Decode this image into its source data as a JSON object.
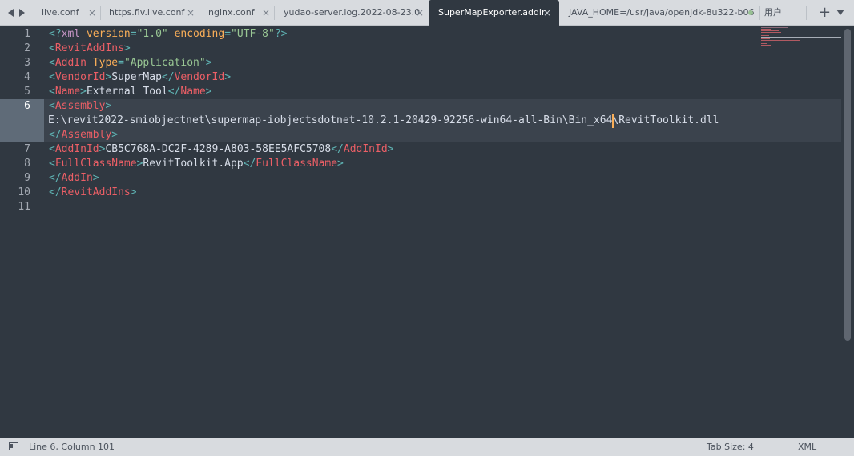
{
  "tabs": [
    {
      "label": "live.conf",
      "active": false
    },
    {
      "label": "https.flv.live.conf",
      "active": false
    },
    {
      "label": "nginx.conf",
      "active": false
    },
    {
      "label": "yudao-server.log.2022-08-23.0",
      "active": false
    },
    {
      "label": "SuperMapExporter.addin",
      "active": true
    },
    {
      "label": "JAVA_HOME=/usr/java/openjdk-8u322-b06",
      "active": false
    },
    {
      "label": "用户",
      "active": false
    }
  ],
  "tab_close_glyph": "×",
  "tab_new_glyph": "+",
  "icons": [
    "back-icon",
    "forward-icon",
    "close-icon",
    "modified-dot-icon",
    "plus-icon",
    "chevron-down-icon",
    "panel-icon"
  ],
  "editor": {
    "line_numbers": [
      "1",
      "2",
      "3",
      "4",
      "5",
      "6",
      "7",
      "8",
      "9",
      "10",
      "11"
    ],
    "current_line": "6",
    "lines": {
      "l1": {
        "open": "<?",
        "name": "xml",
        "a1": "version",
        "eq1": "=",
        "v1": "\"1.0\"",
        "a2": "encoding",
        "eq2": "=",
        "v2": "\"UTF-8\"",
        "close": "?>"
      },
      "l2": {
        "open": "<",
        "name": "RevitAddIns",
        "close": ">"
      },
      "l3": {
        "open": "<",
        "name": "AddIn",
        "a1": "Type",
        "eq1": "=",
        "v1": "\"Application\"",
        "close": ">"
      },
      "l4": {
        "open": "<",
        "name": "VendorId",
        "close": ">",
        "text": "SuperMap",
        "eopen": "</",
        "ename": "VendorId",
        "eclose": ">"
      },
      "l5": {
        "open": "<",
        "name": "Name",
        "close": ">",
        "text": "External Tool",
        "eopen": "</",
        "ename": "Name",
        "eclose": ">"
      },
      "l6a": {
        "open": "<",
        "name": "Assembly",
        "close": ">"
      },
      "l6b": {
        "text_before": "E:\\revit2022-smiobjectnet\\supermap-iobjectsdotnet-10.2.1-20429-92256-win64-all-Bin\\Bin_x64",
        "text_after": "\\RevitToolkit.dll"
      },
      "l6c": {
        "open": "</",
        "name": "Assembly",
        "close": ">"
      },
      "l7": {
        "open": "<",
        "name": "AddInId",
        "close": ">",
        "text": "CB5C768A-DC2F-4289-A803-58EE5AFC5708",
        "eopen": "</",
        "ename": "AddInId",
        "eclose": ">"
      },
      "l8": {
        "open": "<",
        "name": "FullClassName",
        "close": ">",
        "text": "RevitToolkit.App",
        "eopen": "</",
        "ename": "FullClassName",
        "eclose": ">"
      },
      "l9": {
        "open": "</",
        "name": "AddIn",
        "close": ">"
      },
      "l10": {
        "open": "</",
        "name": "RevitAddIns",
        "close": ">"
      }
    }
  },
  "status": {
    "position": "Line 6, Column 101",
    "tab_size": "Tab Size: 4",
    "syntax": "XML"
  },
  "colors": {
    "editor_bg": "#303841",
    "tag": "#ec5f66",
    "punctuation": "#5fb4b4",
    "attribute": "#f9ae58",
    "string": "#99c794",
    "caret": "#f9ae58"
  }
}
